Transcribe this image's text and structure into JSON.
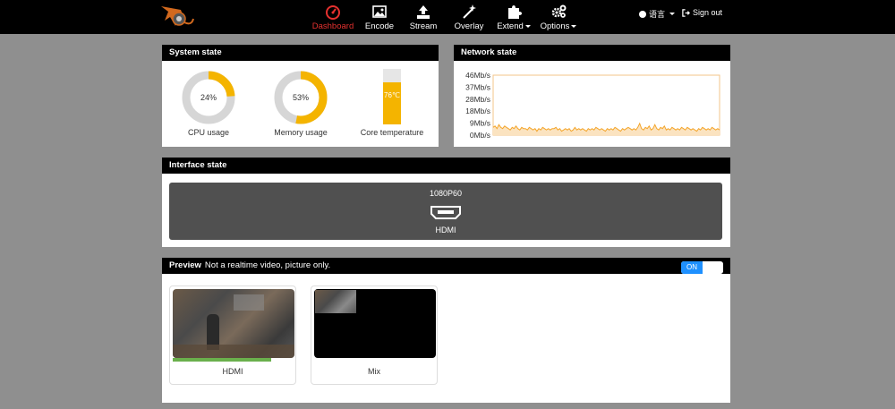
{
  "nav": {
    "items": [
      {
        "label": "Dashboard",
        "icon": "dashboard-icon",
        "active": true
      },
      {
        "label": "Encode",
        "icon": "image-icon"
      },
      {
        "label": "Stream",
        "icon": "upload-icon"
      },
      {
        "label": "Overlay",
        "icon": "magic-wand-icon"
      },
      {
        "label": "Extend",
        "icon": "puzzle-icon"
      },
      {
        "label": "Options",
        "icon": "gears-icon"
      }
    ],
    "language": "语言",
    "sign_out": "Sign out"
  },
  "system_state": {
    "title": "System state",
    "cpu": {
      "value": 24,
      "text": "24%",
      "label": "CPU usage"
    },
    "memory": {
      "value": 53,
      "text": "53%",
      "label": "Memory usage"
    },
    "temperature": {
      "value": 76,
      "text": "76℃",
      "label": "Core temperature"
    }
  },
  "network_state": {
    "title": "Network state"
  },
  "chart_data": {
    "type": "line",
    "title": "",
    "xlabel": "",
    "ylabel": "",
    "yticks": [
      "46Mb/s",
      "37Mb/s",
      "28Mb/s",
      "18Mb/s",
      "9Mb/s",
      "0Mb/s"
    ],
    "ylim": [
      0,
      46
    ],
    "grid": false,
    "color": "#f4a52a",
    "series": [
      {
        "values": [
          6,
          7,
          5,
          8,
          6,
          5,
          7,
          6,
          5,
          4,
          6,
          5,
          7,
          5,
          4,
          6,
          5,
          5,
          4,
          6,
          5,
          4,
          5,
          3,
          5,
          4,
          6,
          5,
          4,
          5,
          4,
          5,
          5,
          6,
          4,
          5,
          3,
          4,
          5,
          4,
          5,
          3,
          4,
          6,
          4,
          5,
          4,
          5,
          4,
          3,
          5,
          4,
          5,
          4,
          6,
          5,
          4,
          5,
          4,
          3,
          5,
          4,
          5,
          4,
          6,
          5,
          4,
          3,
          5,
          4,
          5,
          6,
          5,
          4,
          5,
          4,
          6,
          9,
          5,
          4,
          6,
          5,
          7,
          4,
          5,
          8,
          5,
          4,
          6,
          5,
          7,
          4,
          5,
          4,
          6,
          5,
          4,
          5,
          4,
          6,
          5,
          4,
          6,
          5,
          4,
          5,
          4,
          3,
          5,
          4,
          6,
          5,
          4,
          5,
          4,
          6,
          5,
          4,
          5,
          4
        ]
      }
    ]
  },
  "interface_state": {
    "title": "Interface state",
    "resolution": "1080P60",
    "port": "HDMI"
  },
  "preview": {
    "title": "Preview",
    "subtitle": "Not a realtime video, picture only.",
    "toggle": "ON",
    "cards": [
      {
        "label": "HDMI"
      },
      {
        "label": "Mix"
      }
    ]
  },
  "colors": {
    "accent": "#f4b400",
    "active_nav": "#e5312f",
    "toggle_on": "#1e90ff",
    "chart_line": "#f4a52a"
  }
}
